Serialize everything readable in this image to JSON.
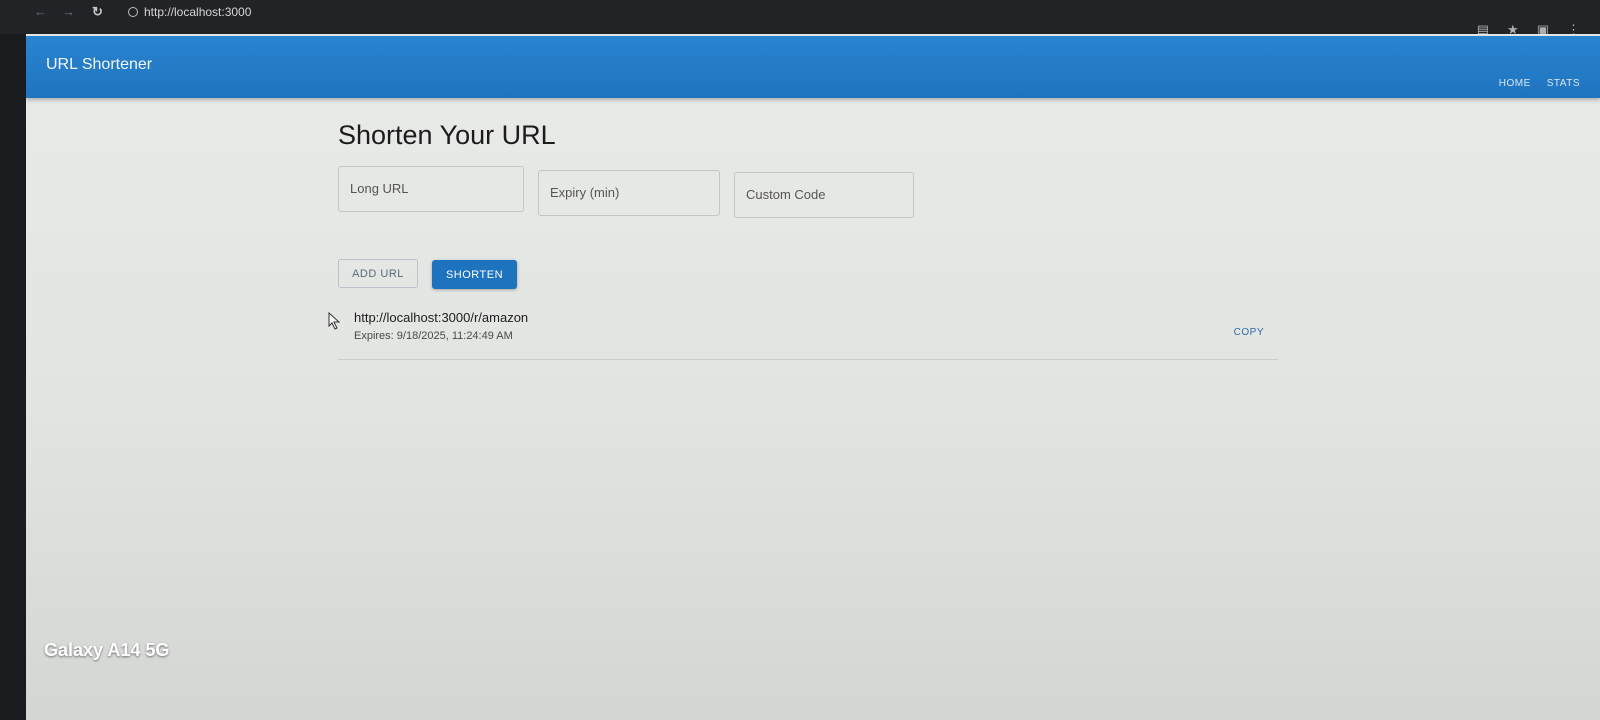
{
  "browser": {
    "url": "http://localhost:3000"
  },
  "appbar": {
    "brand": "URL Shortener",
    "nav": [
      "HOME",
      "STATS"
    ]
  },
  "main": {
    "title": "Shorten Your URL",
    "fields": {
      "long_url_placeholder": "Long URL",
      "expiry_placeholder": "Expiry (min)",
      "custom_code_placeholder": "Custom Code"
    },
    "buttons": {
      "add_url": "ADD URL",
      "shorten": "SHORTEN"
    },
    "results": [
      {
        "short_url": "http://localhost:3000/r/amazon",
        "expires": "Expires: 9/18/2025, 11:24:49 AM",
        "copy_label": "COPY"
      }
    ]
  },
  "watermark": "Galaxy A14 5G",
  "colors": {
    "appbar": "#1f74bf",
    "primary_button": "#1e73be",
    "page_background": "#e5e7e4"
  }
}
